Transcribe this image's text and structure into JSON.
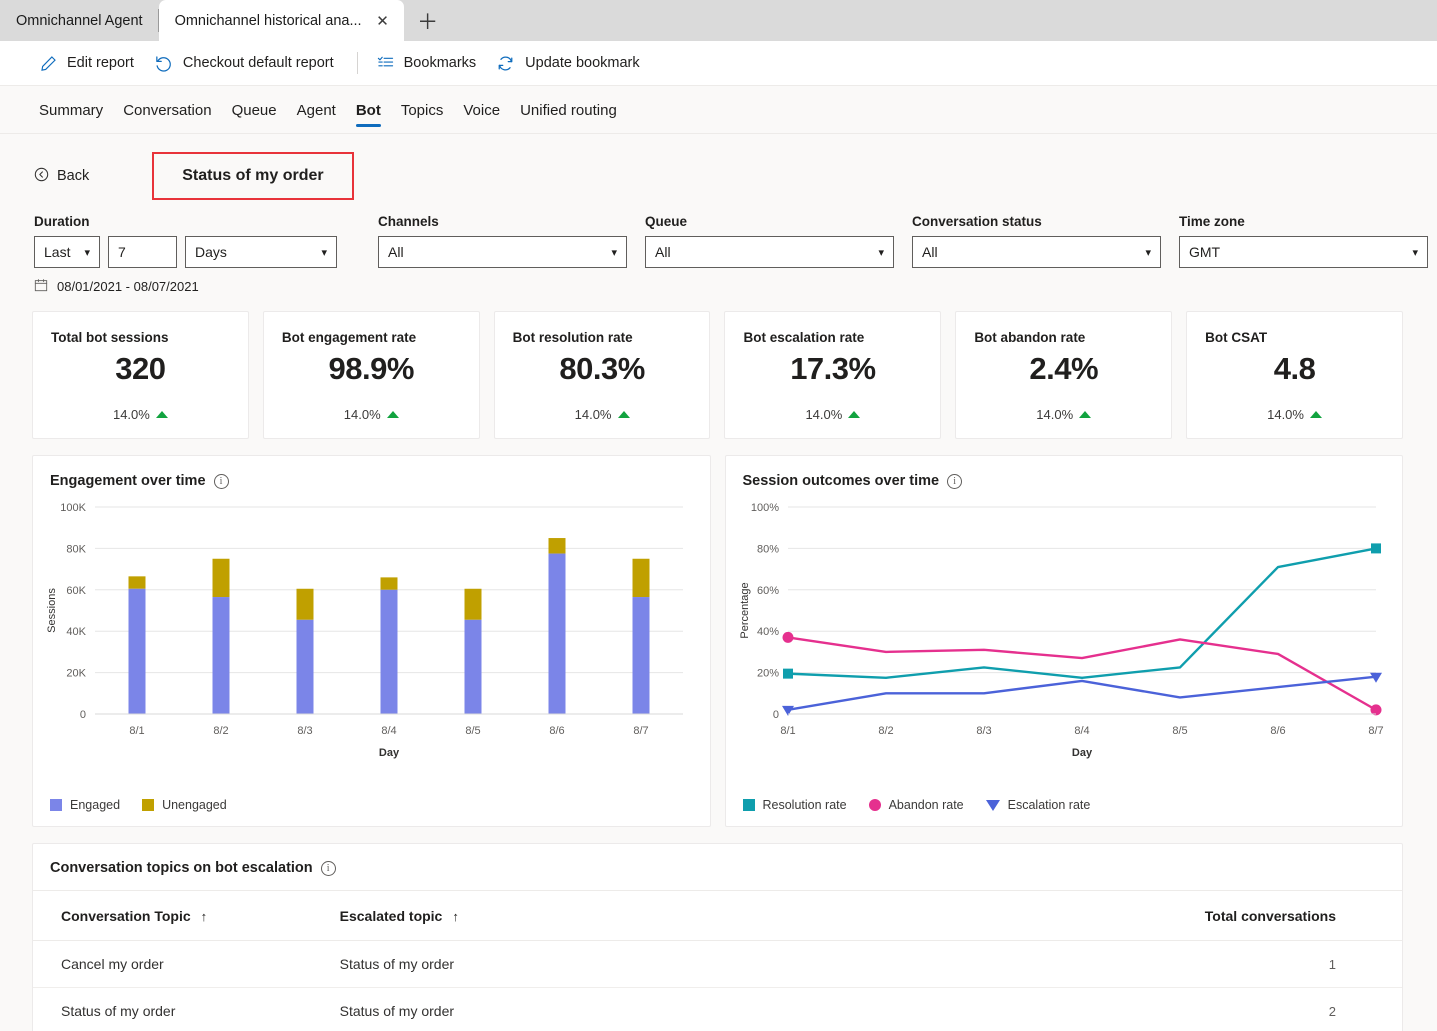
{
  "browser": {
    "tabs": [
      {
        "title": "Omnichannel Agent",
        "active": false
      },
      {
        "title": "Omnichannel historical ana...",
        "active": true
      }
    ],
    "close_icon": "✕",
    "newtab_icon": "＋"
  },
  "commandbar": {
    "edit_report": "Edit report",
    "checkout_default": "Checkout default report",
    "bookmarks": "Bookmarks",
    "update_bookmark": "Update bookmark"
  },
  "nav": {
    "tabs": [
      "Summary",
      "Conversation",
      "Queue",
      "Agent",
      "Bot",
      "Topics",
      "Voice",
      "Unified routing"
    ],
    "active": "Bot"
  },
  "subheader": {
    "back_label": "Back",
    "back_icon": "←",
    "drill_title": "Status of my order",
    "highlight_color": "#e8333a"
  },
  "filters": {
    "duration": {
      "label": "Duration",
      "mode": "Last",
      "amount": "7",
      "unit": "Days"
    },
    "channels": {
      "label": "Channels",
      "value": "All"
    },
    "queue": {
      "label": "Queue",
      "value": "All"
    },
    "conversation_status": {
      "label": "Conversation status",
      "value": "All"
    },
    "time_zone": {
      "label": "Time zone",
      "value": "GMT"
    },
    "date_range": "08/01/2021 - 08/07/2021"
  },
  "kpis": [
    {
      "title": "Total bot sessions",
      "value": "320",
      "delta": "14.0%",
      "trend": "up"
    },
    {
      "title": "Bot engagement rate",
      "value": "98.9%",
      "delta": "14.0%",
      "trend": "up"
    },
    {
      "title": "Bot resolution rate",
      "value": "80.3%",
      "delta": "14.0%",
      "trend": "up"
    },
    {
      "title": "Bot escalation rate",
      "value": "17.3%",
      "delta": "14.0%",
      "trend": "up"
    },
    {
      "title": "Bot abandon rate",
      "value": "2.4%",
      "delta": "14.0%",
      "trend": "up"
    },
    {
      "title": "Bot CSAT",
      "value": "4.8",
      "delta": "14.0%",
      "trend": "up"
    }
  ],
  "engagement_panel": {
    "title": "Engagement over time",
    "legend": [
      {
        "label": "Engaged",
        "color": "#7b85e8",
        "marker": "square"
      },
      {
        "label": "Unengaged",
        "color": "#c0a000",
        "marker": "square"
      }
    ]
  },
  "outcomes_panel": {
    "title": "Session outcomes over time",
    "legend": [
      {
        "label": "Resolution rate",
        "color": "#0f9ead",
        "marker": "square"
      },
      {
        "label": "Abandon rate",
        "color": "#e5308e",
        "marker": "circle"
      },
      {
        "label": "Escalation rate",
        "color": "#4b62d9",
        "marker": "triangle-down"
      }
    ]
  },
  "table_panel": {
    "title": "Conversation topics on bot escalation",
    "columns": [
      {
        "label": "Conversation Topic",
        "sort": "↑",
        "align": "left"
      },
      {
        "label": "Escalated topic",
        "sort": "↑",
        "align": "left"
      },
      {
        "label": "Total conversations",
        "sort": "",
        "align": "right"
      }
    ],
    "rows": [
      {
        "topic": "Cancel my order",
        "escalated": "Status of my order",
        "total": "1"
      },
      {
        "topic": "Status of my order",
        "escalated": "Status of my order",
        "total": "2"
      }
    ]
  },
  "chart_data": [
    {
      "type": "bar",
      "stacked": true,
      "title": "Engagement over time",
      "xlabel": "Day",
      "ylabel": "Sessions",
      "categories": [
        "8/1",
        "8/2",
        "8/3",
        "8/4",
        "8/5",
        "8/6",
        "8/7"
      ],
      "ylim": [
        0,
        100000
      ],
      "yticks": [
        0,
        20000,
        40000,
        60000,
        80000,
        100000
      ],
      "ytick_labels": [
        "0",
        "20K",
        "40K",
        "60K",
        "80K",
        "100K"
      ],
      "grid": true,
      "legend_position": "bottom-left",
      "series": [
        {
          "name": "Engaged",
          "color": "#7b85e8",
          "values": [
            60500,
            56500,
            45500,
            60000,
            45500,
            77500,
            56500
          ]
        },
        {
          "name": "Unengaged",
          "color": "#c0a000",
          "values": [
            6000,
            18500,
            15000,
            6000,
            15000,
            7500,
            18500
          ]
        }
      ]
    },
    {
      "type": "line",
      "title": "Session outcomes over time",
      "xlabel": "Day",
      "ylabel": "Percentage",
      "x": [
        "8/1",
        "8/2",
        "8/3",
        "8/4",
        "8/5",
        "8/6",
        "8/7"
      ],
      "ylim": [
        0,
        100
      ],
      "yticks": [
        0,
        20,
        40,
        60,
        80,
        100
      ],
      "ytick_labels": [
        "0",
        "20%",
        "40%",
        "60%",
        "80%",
        "100%"
      ],
      "grid": true,
      "legend_position": "bottom-left",
      "series": [
        {
          "name": "Resolution rate",
          "color": "#0f9ead",
          "marker": "square",
          "values": [
            19.5,
            17.5,
            22.5,
            17.5,
            22.5,
            71,
            80
          ]
        },
        {
          "name": "Abandon rate",
          "color": "#e5308e",
          "marker": "circle",
          "values": [
            37,
            30,
            31,
            27,
            36,
            29,
            2
          ]
        },
        {
          "name": "Escalation rate",
          "color": "#4b62d9",
          "marker": "triangle-down",
          "values": [
            2,
            10,
            10,
            16,
            8,
            13,
            18
          ]
        }
      ]
    }
  ]
}
